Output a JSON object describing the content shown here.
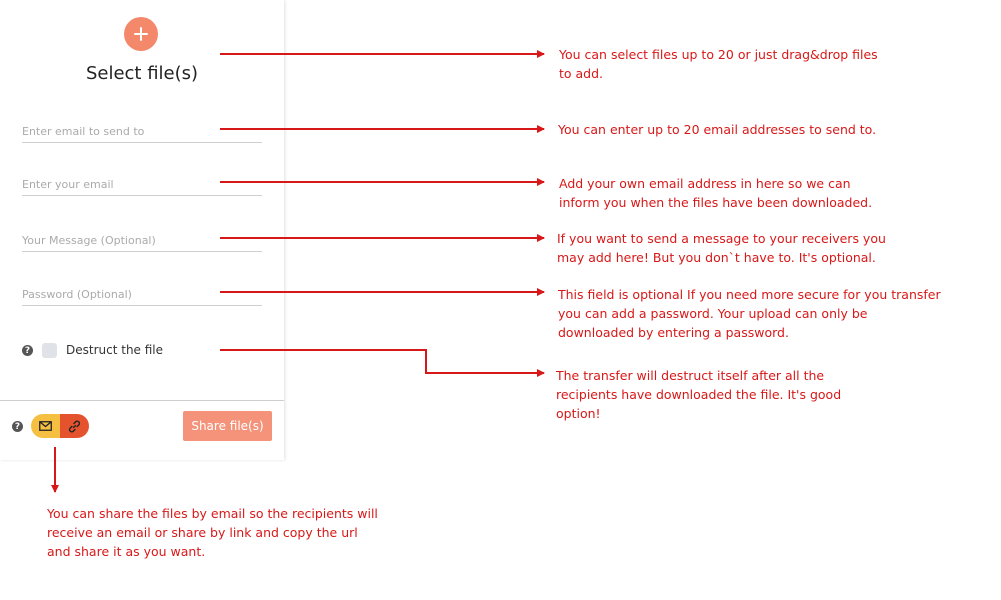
{
  "panel": {
    "select_title": "Select file(s)",
    "fields": {
      "send_to_placeholder": "Enter email to send to",
      "your_email_placeholder": "Enter your email",
      "message_placeholder": "Your Message (Optional)",
      "password_placeholder": "Password (Optional)"
    },
    "destruct_label": "Destruct the file",
    "share_button": "Share file(s)"
  },
  "annotations": {
    "select_files": "You can select files up to 20 or just drag&drop files to add.",
    "send_to": "You can enter up to 20 email addresses to send to.",
    "your_email": "Add your own email address in here so we can inform you when the files have been downloaded.",
    "message": "If you want to send a message to your receivers you may add here! But you don`t have to. It's optional.",
    "password": "This field is optional If you need more secure for you transfer you can add a password. Your upload can only be downloaded by entering a password.",
    "destruct": "The transfer will destruct itself after all the recipients have downloaded the file. It's good option!",
    "share_mode": "You can share the files by email so the recipients will receive an email or share by link and copy the url and share it as you want."
  },
  "colors": {
    "accent": "#f4886a",
    "annotation_red": "#d81818",
    "email_toggle": "#f5c042",
    "link_toggle": "#e4532e"
  },
  "icons": {
    "add": "plus-icon",
    "help": "question-icon",
    "email": "envelope-icon",
    "link": "link-icon"
  }
}
